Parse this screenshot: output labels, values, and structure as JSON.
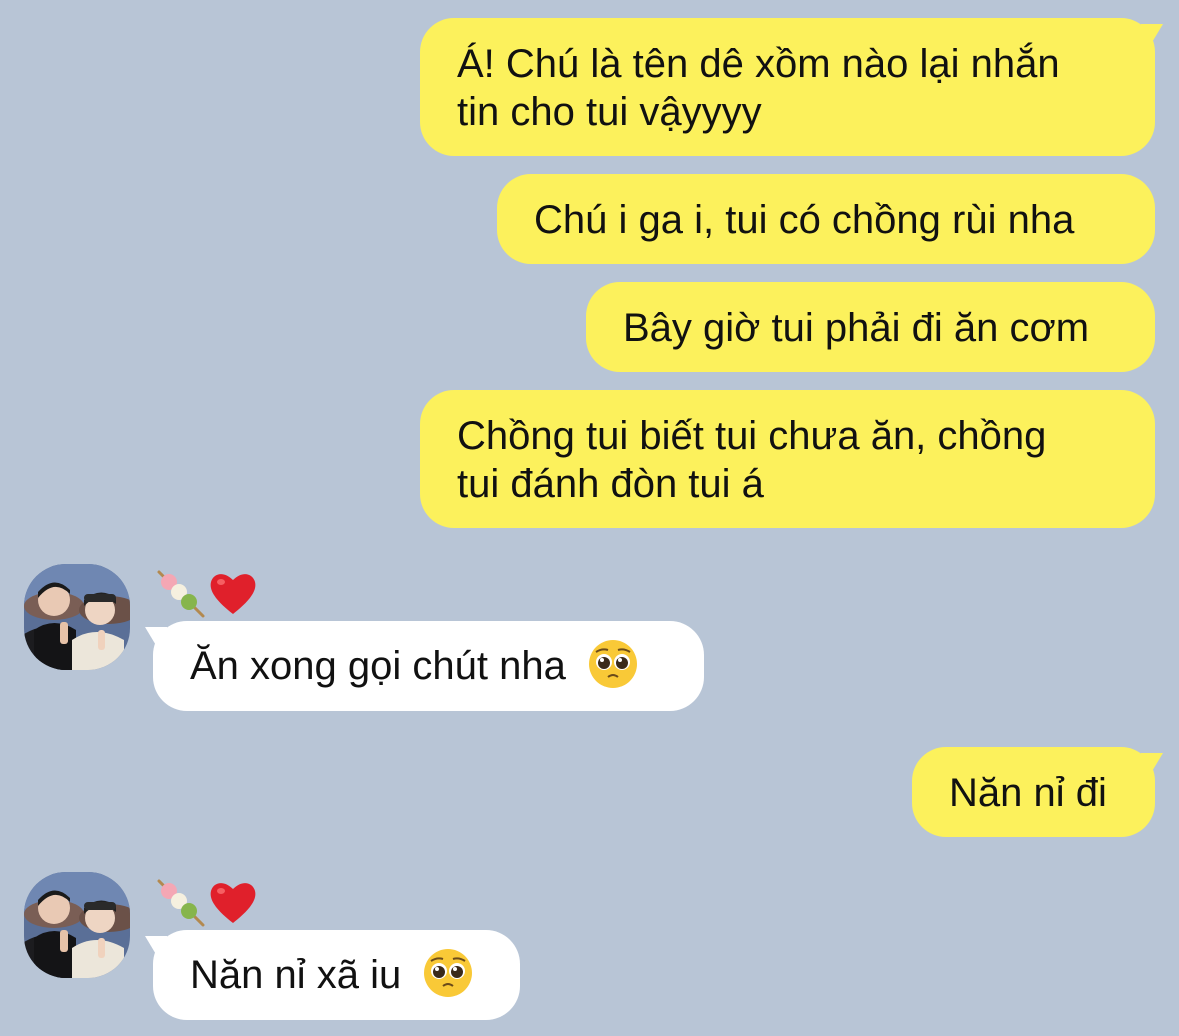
{
  "messages": {
    "m1": {
      "line1": "Á! Chú là tên dê xồm nào lại nhắn",
      "line2": "tin cho tui vậyyyy"
    },
    "m2": {
      "text": "Chú i ga i, tui có chồng rùi nha"
    },
    "m3": {
      "text": "Bây giờ tui phải đi ăn cơm"
    },
    "m4": {
      "line1": "Chồng tui biết tui chưa ăn, chồng",
      "line2": "tui đánh đòn tui á"
    },
    "m5": {
      "text": "Ăn xong gọi chút nha"
    },
    "m6": {
      "text": "Năn nỉ đi"
    },
    "m7": {
      "text": "Năn nỉ xã iu"
    }
  },
  "contact": {
    "name_icons": [
      "dango-icon",
      "red-heart-icon"
    ],
    "avatar": "avatar-photo"
  },
  "emojis": {
    "m5_emoji": "pleading-face-icon",
    "m7_emoji": "pleading-face-icon"
  },
  "colors": {
    "background": "#b8c5d6",
    "outgoing_bubble": "#fcf15c",
    "incoming_bubble": "#ffffff"
  }
}
